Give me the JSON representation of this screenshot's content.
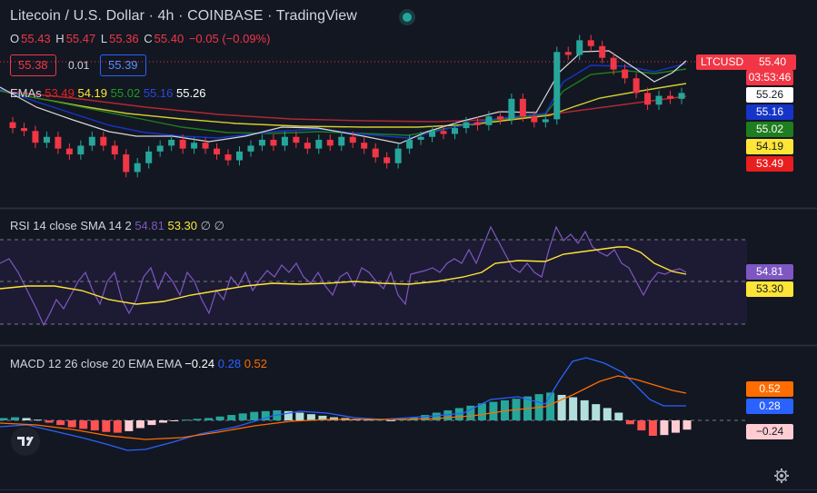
{
  "header": {
    "title": "Litecoin / U.S. Dollar · 4h · COINBASE · TradingView",
    "ohlc": {
      "o_label": "O",
      "o": "55.43",
      "h_label": "H",
      "h": "55.47",
      "l_label": "L",
      "l": "55.36",
      "c_label": "C",
      "c": "55.40",
      "change": "−0.05 (−0.09%)"
    }
  },
  "order": {
    "sell": "55.38",
    "spread": "0.01",
    "buy": "55.39"
  },
  "ema": {
    "label": "EMAs",
    "v1": "53.49",
    "v2": "54.19",
    "v3": "55.02",
    "v4": "55.16",
    "v5": "55.26"
  },
  "price_axis": {
    "symbol": "LTCUSD",
    "last": "55.40",
    "countdown": "03:53:46",
    "tags": [
      "55.26",
      "55.16",
      "55.02",
      "54.19",
      "53.49"
    ]
  },
  "rsi": {
    "label": "RSI 14 close SMA 14 2",
    "value": "54.81",
    "sma": "53.30",
    "extra": "∅ ∅",
    "tag_value": "54.81",
    "tag_sma": "53.30"
  },
  "macd": {
    "label": "MACD 12 26 close 20 EMA EMA",
    "hist": "−0.24",
    "macd": "0.28",
    "signal": "0.52",
    "tag_signal": "0.52",
    "tag_macd": "0.28",
    "tag_hist": "−0.24"
  },
  "colors": {
    "bg": "#131722",
    "up": "#26a69a",
    "down": "#f23645",
    "ema_red": "#e91e1e",
    "ema_yellow": "#e8e337",
    "ema_green": "#1e7d1e",
    "ema_blue": "#1535c8",
    "ema_white": "#e0e0e0",
    "rsi": "#7e57c2",
    "rsi_sma": "#ffe537",
    "macd": "#2962ff",
    "signal": "#ff6d00"
  },
  "logo": "tradingview-logo",
  "settings_icon": "gear-icon",
  "chart_data": {
    "type": "candlestick",
    "candles_sampled": [
      [
        54.4,
        54.2
      ],
      [
        54.2,
        54.1
      ],
      [
        54.1,
        53.7
      ],
      [
        53.7,
        53.9
      ],
      [
        53.9,
        53.5
      ],
      [
        53.5,
        53.3
      ],
      [
        53.3,
        53.6
      ],
      [
        53.6,
        53.9
      ],
      [
        53.9,
        53.6
      ],
      [
        53.6,
        53.3
      ],
      [
        53.3,
        52.7
      ],
      [
        52.7,
        53.0
      ],
      [
        53.0,
        53.4
      ],
      [
        53.4,
        53.6
      ],
      [
        53.6,
        53.8
      ],
      [
        53.8,
        53.5
      ],
      [
        53.5,
        53.7
      ],
      [
        53.7,
        53.5
      ],
      [
        53.5,
        53.3
      ],
      [
        53.3,
        53.1
      ],
      [
        53.1,
        53.4
      ],
      [
        53.4,
        53.6
      ],
      [
        53.6,
        53.8
      ],
      [
        53.8,
        53.6
      ],
      [
        53.6,
        53.9
      ],
      [
        53.9,
        53.7
      ],
      [
        53.7,
        53.5
      ],
      [
        53.5,
        53.8
      ],
      [
        53.8,
        53.6
      ],
      [
        53.6,
        53.9
      ],
      [
        53.9,
        53.7
      ],
      [
        53.7,
        53.5
      ],
      [
        53.5,
        53.2
      ],
      [
        53.2,
        53.0
      ],
      [
        53.0,
        53.5
      ],
      [
        53.5,
        53.8
      ],
      [
        53.8,
        53.9
      ],
      [
        53.9,
        54.1
      ],
      [
        54.1,
        54.0
      ],
      [
        54.0,
        54.2
      ],
      [
        54.2,
        54.4
      ],
      [
        54.4,
        54.3
      ],
      [
        54.3,
        54.6
      ],
      [
        54.6,
        54.5
      ],
      [
        54.5,
        55.2
      ],
      [
        55.2,
        54.6
      ],
      [
        54.6,
        54.4
      ],
      [
        54.4,
        54.5
      ],
      [
        54.5,
        56.8
      ],
      [
        56.8,
        56.7
      ],
      [
        56.7,
        57.2
      ],
      [
        57.2,
        57.0
      ],
      [
        57.0,
        56.6
      ],
      [
        56.6,
        56.2
      ],
      [
        56.2,
        55.9
      ],
      [
        55.9,
        55.4
      ],
      [
        55.4,
        55.0
      ],
      [
        55.0,
        55.3
      ],
      [
        55.3,
        55.2
      ],
      [
        55.2,
        55.4
      ]
    ]
  }
}
